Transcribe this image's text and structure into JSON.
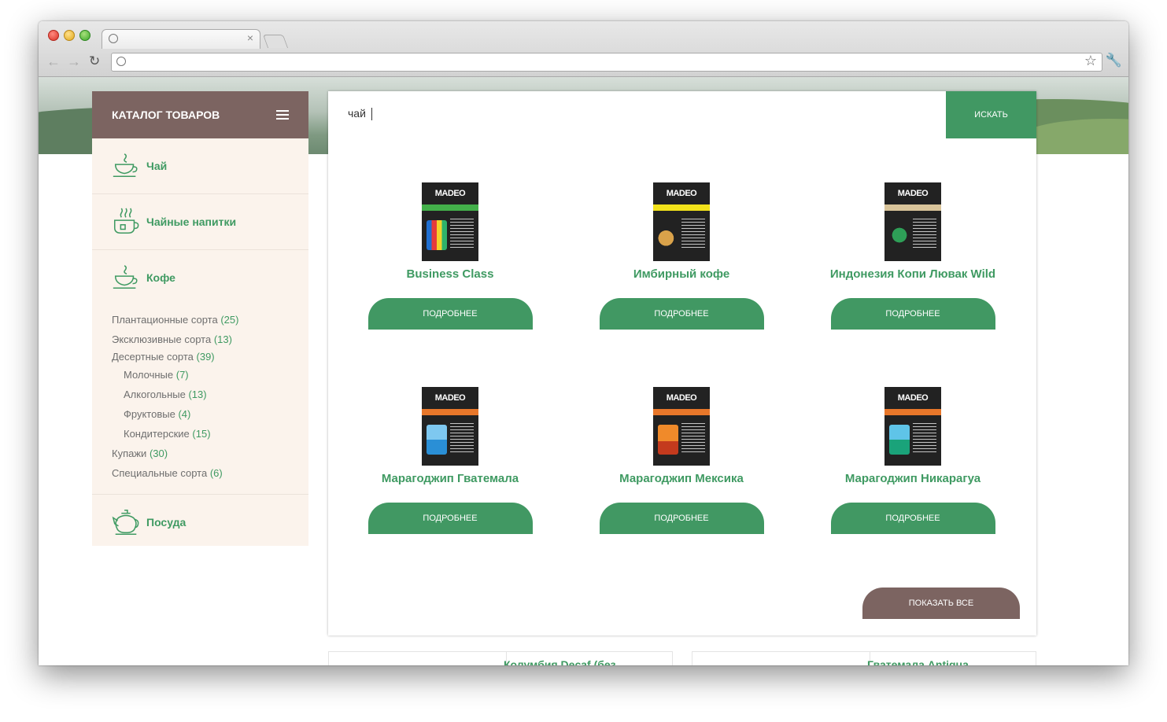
{
  "browser": {
    "tab_close": "×",
    "new_tab": "",
    "back": "←",
    "forward": "→",
    "reload": "↻",
    "star": "☆",
    "wrench": "🔧"
  },
  "sidebar": {
    "title": "КАТАЛОГ ТОВАРОВ",
    "categories": [
      {
        "label": "Чай",
        "icon": "teacup-icon"
      },
      {
        "label": "Чайные напитки",
        "icon": "steaming-cup-icon"
      },
      {
        "label": "Кофе",
        "icon": "coffee-cup-icon"
      },
      {
        "label": "Посуда",
        "icon": "teapot-icon"
      }
    ],
    "coffee_subcategories": [
      {
        "name": "Плантационные сорта",
        "count": "(25)"
      },
      {
        "name": "Эксклюзивные сорта",
        "count": "(13)"
      },
      {
        "name": "Десертные сорта",
        "count": "(39)"
      },
      {
        "name": "Молочные",
        "count": "(7)"
      },
      {
        "name": "Алкогольные",
        "count": "(13)"
      },
      {
        "name": "Фруктовые",
        "count": "(4)"
      },
      {
        "name": "Кондитерские",
        "count": "(15)"
      },
      {
        "name": "Купажи",
        "count": "(30)"
      },
      {
        "name": "Специальные сорта",
        "count": "(6)"
      }
    ]
  },
  "search": {
    "value": "чай",
    "button": "ИСКАТЬ"
  },
  "products": [
    {
      "name": "Business Class",
      "button": "ПОДРОБНЕЕ",
      "band": "#43b04a"
    },
    {
      "name": "Имбирный кофе",
      "button": "ПОДРОБНЕЕ",
      "band": "#f2e21a"
    },
    {
      "name": "Индонезия Копи Лювак Wild",
      "button": "ПОДРОБНЕЕ",
      "band": "#d9c49a"
    },
    {
      "name": "Марагоджип Гватемала",
      "button": "ПОДРОБНЕЕ",
      "band": "#e8772a"
    },
    {
      "name": "Марагоджип Мексика",
      "button": "ПОДРОБНЕЕ",
      "band": "#e8772a"
    },
    {
      "name": "Марагоджип Никарагуа",
      "button": "ПОДРОБНЕЕ",
      "band": "#e8772a"
    }
  ],
  "pack_brand": "MADEO",
  "show_all": "ПОКАЗАТЬ ВСЕ",
  "below_cards": [
    {
      "title": "Колумбия Decaf (без"
    },
    {
      "title": "Гватемала Antigua"
    }
  ],
  "colors": {
    "accent": "#419863",
    "brown": "#7c6461"
  }
}
